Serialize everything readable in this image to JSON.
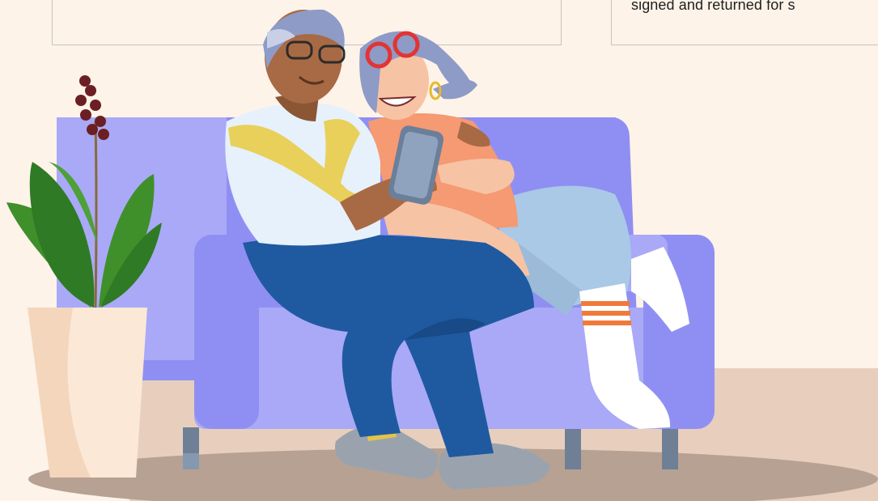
{
  "cards": {
    "right_text": "signed and returned for s"
  },
  "colors": {
    "background": "#fdf3e8",
    "floor_band": "#e8cfbd",
    "rug": "#b7a193",
    "sofa": "#8f8ff3",
    "sofa_light": "#a9a9f7",
    "pot": "#fbe8d6",
    "leaf": "#3f8f2b",
    "berries": "#6b1f24"
  },
  "illustration": {
    "subject": "couple-on-sofa-with-phone",
    "icons": [
      "potted-plant-icon",
      "sofa-icon",
      "smartphone-icon"
    ]
  }
}
